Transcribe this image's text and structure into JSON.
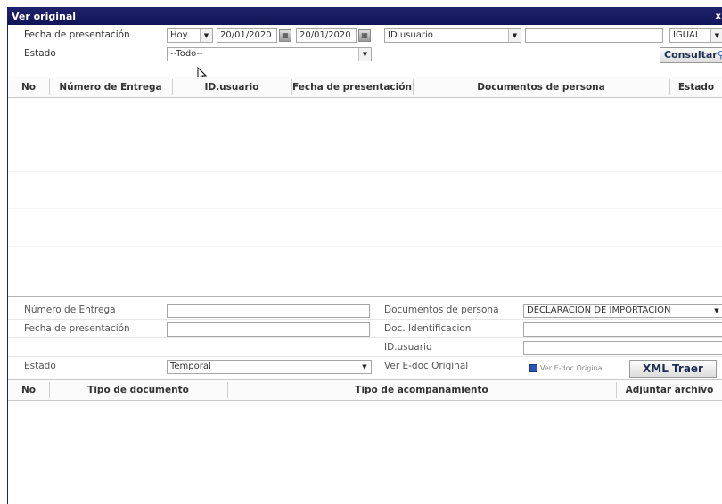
{
  "window": {
    "title": "Ver original",
    "close": "x"
  },
  "search": {
    "fecha_label": "Fecha de presentación",
    "period": "Hoy",
    "date_from": "20/01/2020",
    "date_to": "20/01/2020",
    "user_field": "ID.usuario",
    "user_value": "",
    "operator": "IGUAL",
    "estado_label": "Estado",
    "estado_value": "--Todo--",
    "consultar": "Consultar"
  },
  "results_table": {
    "columns": [
      "No",
      "Número de Entrega",
      "ID.usuario",
      "Fecha de presentación",
      "Documentos de persona",
      "Estado"
    ]
  },
  "detail": {
    "numero_label": "Número de Entrega",
    "numero_value": "",
    "fecha_label": "Fecha de presentación",
    "fecha_value": "",
    "docs_label": "Documentos de persona",
    "docs_value": "DECLARACION DE IMPORTACION",
    "doc_id_label": "Doc. Identificacion",
    "doc_id_value": "",
    "user_label": "ID.usuario",
    "user_value": "",
    "estado_label": "Estado",
    "estado_value": "Temporal",
    "edoc_label": "Ver E-doc Original",
    "edoc_link": "Ver E-doc Original",
    "xml_button": "XML Traer"
  },
  "attach_table": {
    "columns": [
      "No",
      "Tipo de documento",
      "Tipo de acompañamiento",
      "Adjuntar archivo"
    ]
  }
}
